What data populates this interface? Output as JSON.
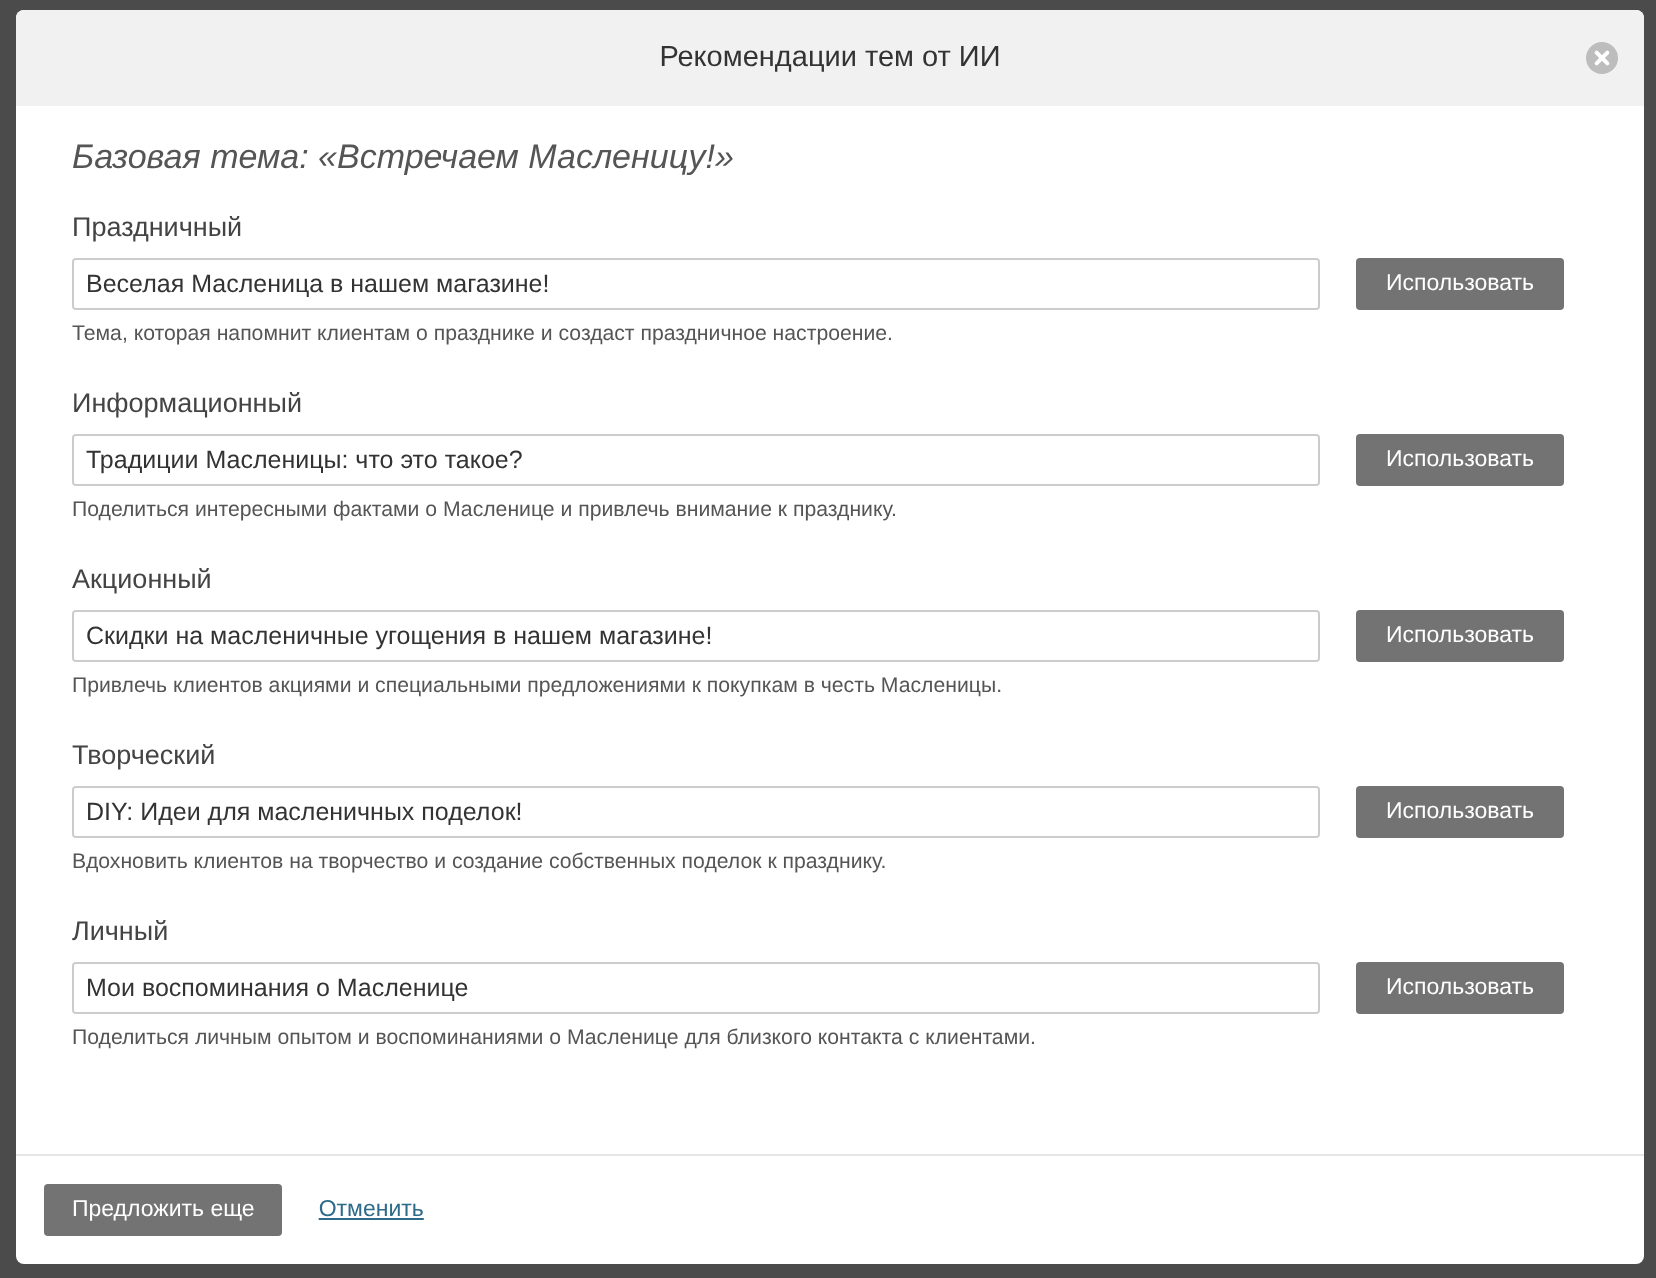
{
  "dialog": {
    "title": "Рекомендации тем от ИИ",
    "base_topic": "Базовая тема: «Встречаем Масленицу!»",
    "suggestions": [
      {
        "category": "Праздничный",
        "value": "Веселая Масленица в нашем магазине!",
        "hint": "Тема, которая напомнит клиентам о празднике и создаст праздничное настроение.",
        "button": "Использовать"
      },
      {
        "category": "Информационный",
        "value": "Традиции Масленицы: что это такое?",
        "hint": "Поделиться интересными фактами о Масленице и привлечь внимание к празднику.",
        "button": "Использовать"
      },
      {
        "category": "Акционный",
        "value": "Скидки на масленичные угощения в нашем магазине!",
        "hint": "Привлечь клиентов акциями и специальными предложениями к покупкам в честь Масленицы.",
        "button": "Использовать"
      },
      {
        "category": "Творческий",
        "value": "DIY: Идеи для масленичных поделок!",
        "hint": "Вдохновить клиентов на творчество и создание собственных поделок к празднику.",
        "button": "Использовать"
      },
      {
        "category": "Личный",
        "value": "Мои воспоминания о Масленице",
        "hint": "Поделиться личным опытом и воспоминаниями о Масленице для близкого контакта с клиентами.",
        "button": "Использовать"
      }
    ],
    "footer": {
      "more_button": "Предложить еще",
      "cancel_link": "Отменить"
    }
  }
}
